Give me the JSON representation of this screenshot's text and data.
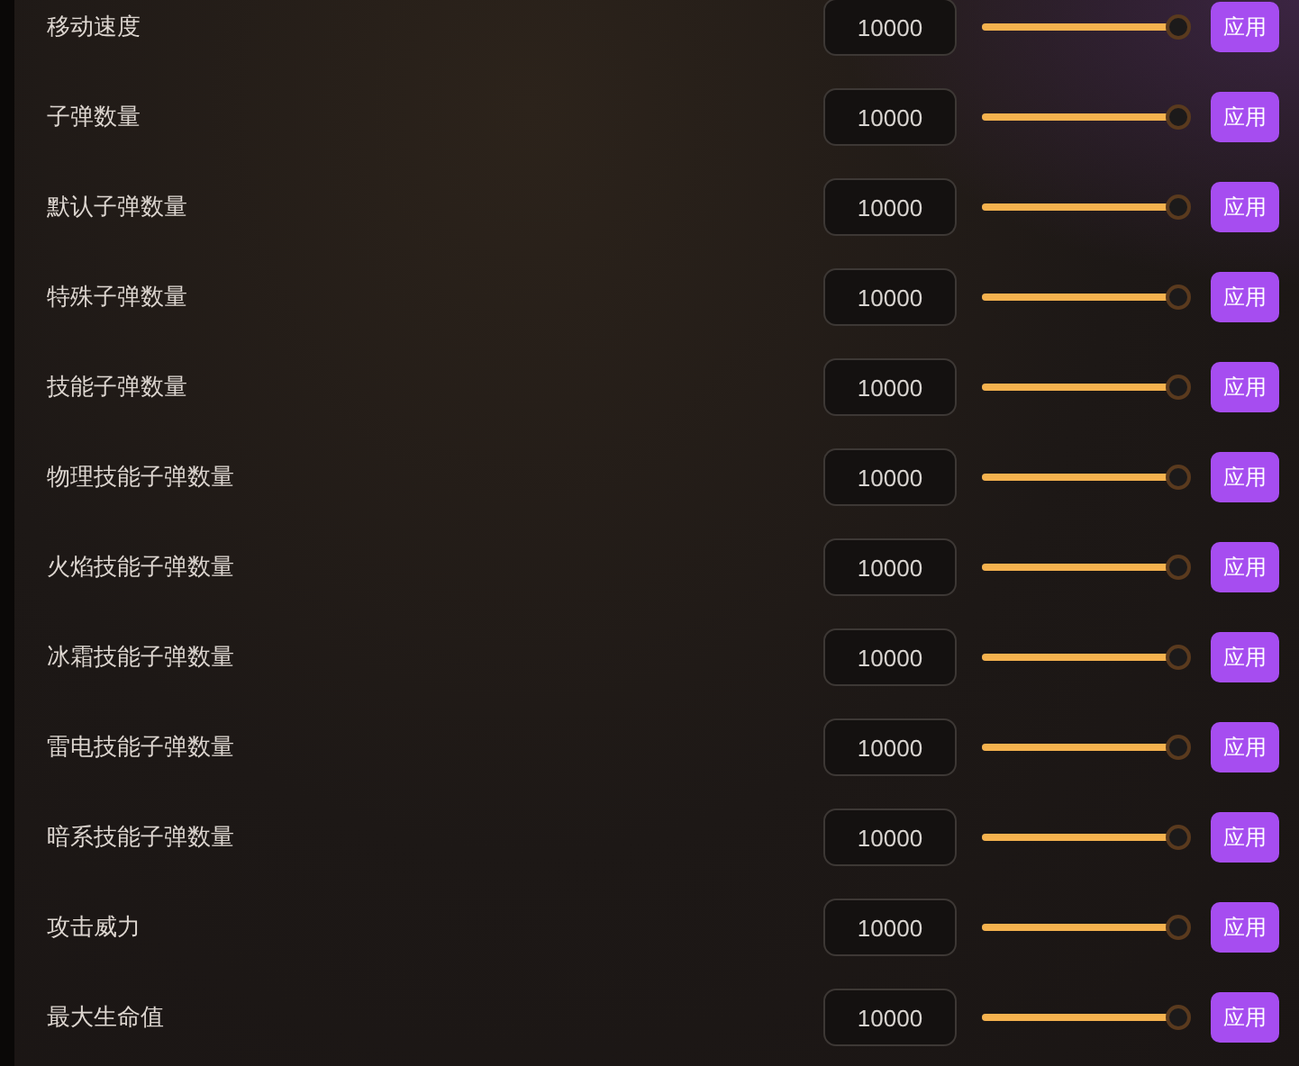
{
  "rows": [
    {
      "label": "移动速度",
      "value": "10000",
      "level": 1,
      "button": "应用"
    },
    {
      "label": "子弹数量",
      "value": "10000",
      "level": 1,
      "button": "应用"
    },
    {
      "label": "默认子弹数量",
      "value": "10000",
      "level": 1,
      "button": "应用"
    },
    {
      "label": "特殊子弹数量",
      "value": "10000",
      "level": 1,
      "button": "应用"
    },
    {
      "label": "技能子弹数量",
      "value": "10000",
      "level": 1,
      "button": "应用"
    },
    {
      "label": "物理技能子弹数量",
      "value": "10000",
      "level": 1,
      "button": "应用"
    },
    {
      "label": "火焰技能子弹数量",
      "value": "10000",
      "level": 1,
      "button": "应用"
    },
    {
      "label": "冰霜技能子弹数量",
      "value": "10000",
      "level": 1,
      "button": "应用"
    },
    {
      "label": "雷电技能子弹数量",
      "value": "10000",
      "level": 1,
      "button": "应用"
    },
    {
      "label": "暗系技能子弹数量",
      "value": "10000",
      "level": 1,
      "button": "应用"
    },
    {
      "label": "攻击威力",
      "value": "10000",
      "level": 1,
      "button": "应用"
    },
    {
      "label": "最大生命值",
      "value": "10000",
      "level": 1,
      "button": "应用"
    }
  ]
}
